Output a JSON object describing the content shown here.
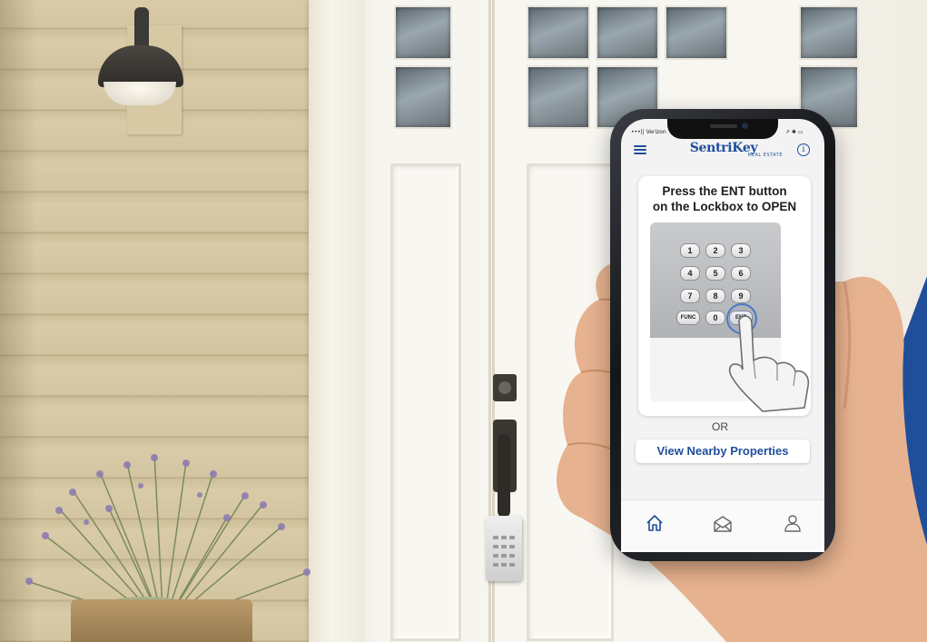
{
  "phone": {
    "status": {
      "carrier": "•••|| Verizon",
      "right": "↗ ✱ ▭"
    },
    "header": {
      "brand": "SentriKey",
      "brand_sub": "REAL ESTATE",
      "menu_icon": "hamburger-menu-icon",
      "info_icon": "info-icon",
      "info_glyph": "i"
    },
    "card": {
      "title_line1": "Press the ENT button",
      "title_line2": "on the Lockbox to OPEN"
    },
    "keypad": {
      "keys": [
        "1",
        "2",
        "3",
        "4",
        "5",
        "6",
        "7",
        "8",
        "9",
        "FUNC",
        "0",
        "ENT"
      ]
    },
    "or_label": "OR",
    "nearby_button": "View Nearby Properties",
    "tabbar": {
      "icons": [
        "home-icon",
        "mail-icon",
        "profile-icon"
      ]
    }
  },
  "colors": {
    "brand_blue": "#1f4e9b",
    "siding": "#d4c5a1",
    "door": "#f8f6f0"
  }
}
